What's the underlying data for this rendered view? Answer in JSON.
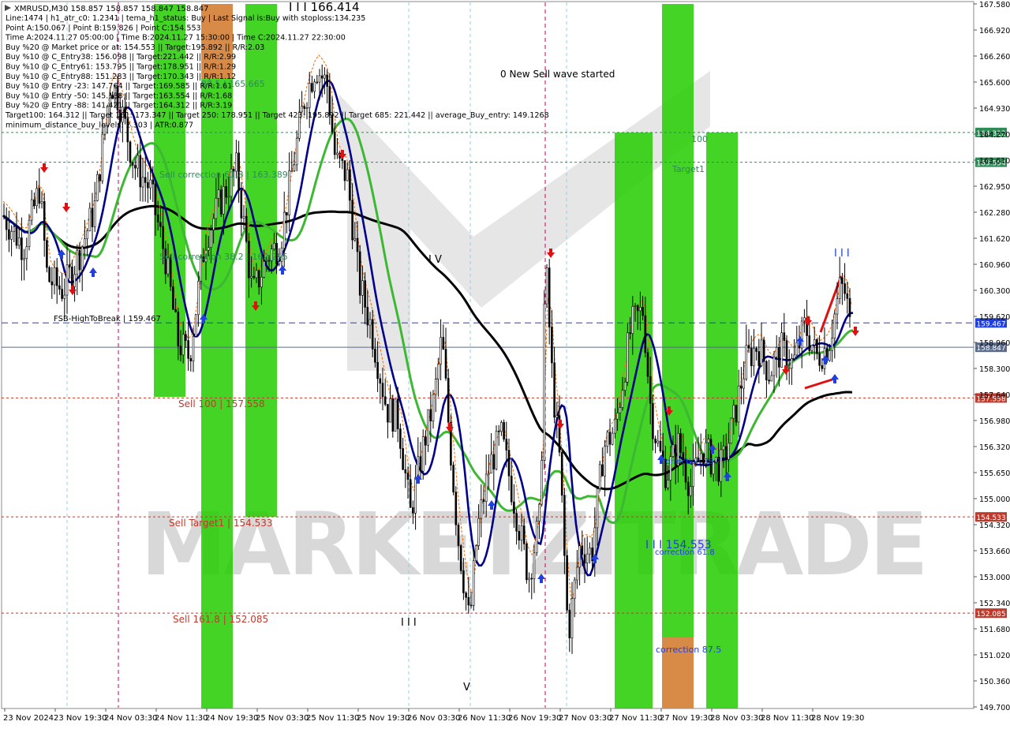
{
  "chart_data": {
    "type": "candlestick",
    "symbol_header": "XMRUSD,M30  158.857 158.857 158.847 158.847",
    "info_lines": [
      "Line:1474 | h1_atr_c0: 1.2341 | tema_h1_status: Buy | Last Signal is:Buy with stoploss:134.235",
      "Point A:150.067 | Point B:159.826 | Point C:154.553",
      "Time A:2024.11.27 05:00:00 | Time B:2024.11.27 15:30:00 | Time C:2024.11.27 22:30:00",
      "Buy %20 @ Market price or at: 154.553 || Target:195.892 || R/R:2.03",
      "Buy %10 @ C_Entry38: 156.098 || Target:221.442 || R/R:2.99",
      "Buy %10 @ C_Entry61: 153.795 || Target:178.951 || R/R:1.29",
      "Buy %10 @ C_Entry88: 151.283 || Target:170.343 || R/R:1.12",
      "Buy %10 @ Entry -23: 147.764 || Target:169.585 || R/R:1.61",
      "Buy %10 @ Entry -50: 145.188 || Target:163.554 || R/R:1.68",
      "Buy %20 @ Entry -88: 141.421 || Target:164.312 || R/R:3.19",
      "Target100: 164.312 || Target 161: 173.347 || Target 250: 178.951 || Target 423: 195.892 || Target 685: 221.442 || average_Buy_entry: 149.1268",
      "minimum_distance_buy_levels: 2.303 | ATR:0.877"
    ],
    "y_ticks": [
      "167.580",
      "166.920",
      "166.260",
      "165.600",
      "164.930",
      "164.270",
      "163.610",
      "162.950",
      "162.280",
      "161.620",
      "160.960",
      "160.300",
      "159.620",
      "158.960",
      "158.300",
      "157.640",
      "156.980",
      "156.320",
      "155.650",
      "155.000",
      "154.320",
      "153.660",
      "153.000",
      "152.340",
      "151.680",
      "151.020",
      "150.360",
      "149.700"
    ],
    "x_ticks": [
      "23 Nov 2024",
      "23 Nov 19:30",
      "24 Nov 03:30",
      "24 Nov 11:30",
      "24 Nov 19:30",
      "25 Nov 03:30",
      "25 Nov 11:30",
      "25 Nov 19:30",
      "26 Nov 03:30",
      "26 Nov 11:30",
      "26 Nov 19:30",
      "27 Nov 03:30",
      "27 Nov 11:30",
      "27 Nov 19:30",
      "28 Nov 03:30",
      "28 Nov 11:30",
      "28 Nov 19:30"
    ],
    "y_range": [
      149.7,
      167.58
    ],
    "horizontal_levels": [
      {
        "price": 164.312,
        "label": "164.312",
        "color": "#2e8b57",
        "style": "dotted"
      },
      {
        "price": 163.554,
        "label": "163.554",
        "color": "#2e8b57",
        "style": "dotted"
      },
      {
        "price": 159.467,
        "label": "159.467",
        "color": "#1f3fe0",
        "style": "dashed"
      },
      {
        "price": 158.847,
        "label": "158.847",
        "color": "#5a6a8a",
        "style": "solid"
      },
      {
        "price": 157.558,
        "label": "157.558",
        "color": "#c0392b",
        "style": "dotted"
      },
      {
        "price": 154.533,
        "label": "154.533",
        "color": "#c0392b",
        "style": "dotted"
      },
      {
        "price": 152.085,
        "label": "152.085",
        "color": "#c0392b",
        "style": "dotted"
      }
    ],
    "annotations": [
      {
        "text": "0 New Sell wave started",
        "color": "#000000"
      },
      {
        "text": "I I I 166.414",
        "color": "#000000"
      },
      {
        "text": "Sell 100 | 157.558",
        "color": "#c0392b"
      },
      {
        "text": "Sell Target1 | 154.533",
        "color": "#c0392b"
      },
      {
        "text": "Sell 161.8 | 152.085",
        "color": "#c0392b"
      },
      {
        "text": "Sell correction 61.8 | 163.389",
        "color": "#2e8b57"
      },
      {
        "text": "Sell correction 38.2 | 162.295",
        "color": "#2e8b57"
      },
      {
        "text": "87.5 | 165.665",
        "color": "#2e8b57"
      },
      {
        "text": "FSB-HighToBreak | 159.467",
        "color": "#000000"
      },
      {
        "text": "100",
        "color": "#2e8b57"
      },
      {
        "text": "Target1",
        "color": "#2e8b57"
      },
      {
        "text": "I V",
        "color": "#000000"
      },
      {
        "text": "I I I",
        "color": "#1f3fe0"
      },
      {
        "text": "I I I",
        "color": "#000000"
      },
      {
        "text": "V",
        "color": "#000000"
      },
      {
        "text": "I I I 154.553",
        "color": "#1f3fe0"
      },
      {
        "text": "correction 61.8",
        "color": "#1f3fe0"
      },
      {
        "text": "correction 38.2",
        "color": "#1f3fe0"
      },
      {
        "text": "correction 87.5",
        "color": "#1f3fe0"
      }
    ],
    "watermark": "MARKETZITRADE",
    "colors": {
      "green_zone": "#22cc00",
      "orange_zone": "#e8834a",
      "ema_fast": "#00008b",
      "ema_mid": "#3cb832",
      "ema_slow": "#000000",
      "candle": "#000000",
      "arrow_buy": "#1f3fe0",
      "arrow_sell": "#e01010"
    }
  }
}
